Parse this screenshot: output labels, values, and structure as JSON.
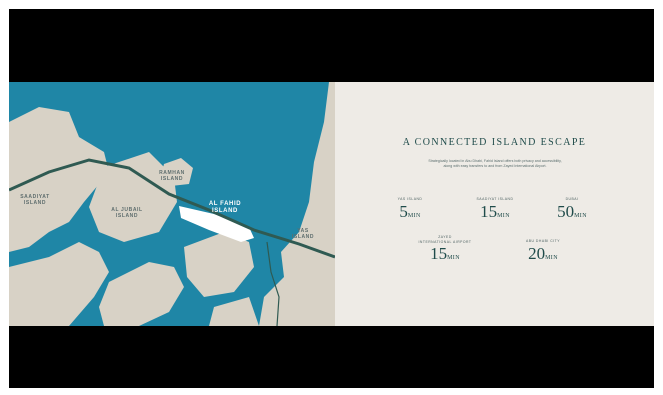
{
  "map": {
    "labels": {
      "saadiyat": "SAADIYAT\nISLAND",
      "al_jubail": "AL JUBAIL\nISLAND",
      "ramhan": "RAMHAN\nISLAND",
      "al_fahid": "AL FAHID\nISLAND",
      "yas": "YAS\nISLAND"
    },
    "colors": {
      "water": "#1f86a6",
      "land": "#d8d2c6",
      "road": "#2f5a52",
      "highlight": "#ffffff"
    }
  },
  "panel": {
    "title": "A CONNECTED ISLAND ESCAPE",
    "description_line1": "Strategically located in Abu Dhabi, Fahid Island offers both privacy and accessibility,",
    "description_line2": "along with easy transfers to and from Zayed International Airport.",
    "stats": [
      {
        "label": "YAS ISLAND",
        "value": "5",
        "unit": "MIN"
      },
      {
        "label": "SAADIYAT ISLAND",
        "value": "15",
        "unit": "MIN"
      },
      {
        "label": "DUBAI",
        "value": "50",
        "unit": "MIN"
      },
      {
        "label": "ZAYED\nINTERNATIONAL AIRPORT",
        "value": "15",
        "unit": "MIN"
      },
      {
        "label": "ABU DHABI CITY",
        "value": "20",
        "unit": "MIN"
      }
    ]
  }
}
